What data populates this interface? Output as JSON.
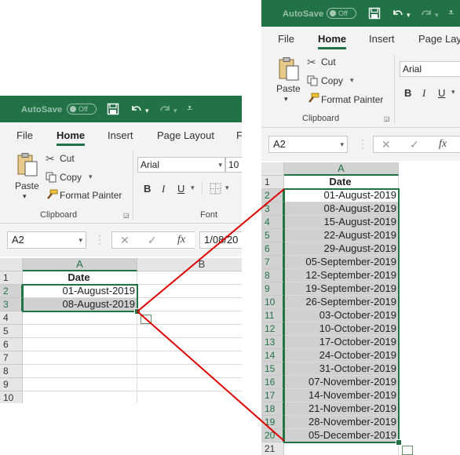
{
  "theme": {
    "excel_green": "#217346",
    "highlight_gray": "#d0d0d0",
    "arrow_red": "#e00000"
  },
  "left": {
    "autosave_label": "AutoSave",
    "autosave_state": "Off",
    "tabs": [
      "File",
      "Home",
      "Insert",
      "Page Layout",
      "F"
    ],
    "active_tab": "Home",
    "clipboard": {
      "paste": "Paste",
      "cut": "Cut",
      "copy": "Copy",
      "format_painter": "Format Painter",
      "group_label": "Clipboard"
    },
    "font": {
      "name": "Arial",
      "size": "10",
      "group_label": "Font"
    },
    "name_box": "A2",
    "formula_value": "1/08/20",
    "columns": [
      "A",
      "B"
    ],
    "rows": [
      {
        "n": "1",
        "a": "Date"
      },
      {
        "n": "2",
        "a": "01-August-2019"
      },
      {
        "n": "3",
        "a": "08-August-2019"
      },
      {
        "n": "4",
        "a": ""
      },
      {
        "n": "5",
        "a": ""
      },
      {
        "n": "6",
        "a": ""
      },
      {
        "n": "7",
        "a": ""
      },
      {
        "n": "8",
        "a": ""
      },
      {
        "n": "9",
        "a": ""
      },
      {
        "n": "10",
        "a": ""
      }
    ]
  },
  "right": {
    "autosave_label": "AutoSave",
    "autosave_state": "Off",
    "tabs": [
      "File",
      "Home",
      "Insert",
      "Page Lay"
    ],
    "active_tab": "Home",
    "clipboard": {
      "paste": "Paste",
      "cut": "Cut",
      "copy": "Copy",
      "format_painter": "Format Painter",
      "group_label": "Clipboard"
    },
    "font": {
      "name": "Arial"
    },
    "name_box": "A2",
    "columns": [
      "A"
    ],
    "rows": [
      {
        "n": "1",
        "a": "Date"
      },
      {
        "n": "2",
        "a": "01-August-2019"
      },
      {
        "n": "3",
        "a": "08-August-2019"
      },
      {
        "n": "4",
        "a": "15-August-2019"
      },
      {
        "n": "5",
        "a": "22-August-2019"
      },
      {
        "n": "6",
        "a": "29-August-2019"
      },
      {
        "n": "7",
        "a": "05-September-2019"
      },
      {
        "n": "8",
        "a": "12-September-2019"
      },
      {
        "n": "9",
        "a": "19-September-2019"
      },
      {
        "n": "10",
        "a": "26-September-2019"
      },
      {
        "n": "11",
        "a": "03-October-2019"
      },
      {
        "n": "12",
        "a": "10-October-2019"
      },
      {
        "n": "13",
        "a": "17-October-2019"
      },
      {
        "n": "14",
        "a": "24-October-2019"
      },
      {
        "n": "15",
        "a": "31-October-2019"
      },
      {
        "n": "16",
        "a": "07-November-2019"
      },
      {
        "n": "17",
        "a": "14-November-2019"
      },
      {
        "n": "18",
        "a": "21-November-2019"
      },
      {
        "n": "19",
        "a": "28-November-2019"
      },
      {
        "n": "20",
        "a": "05-December-2019"
      },
      {
        "n": "21",
        "a": ""
      }
    ]
  }
}
